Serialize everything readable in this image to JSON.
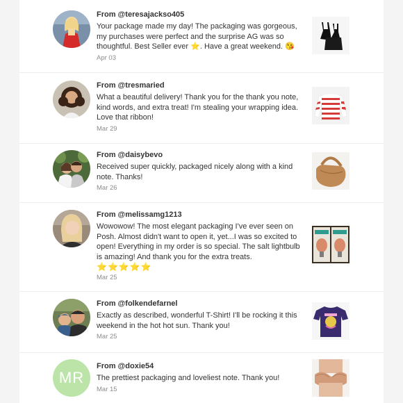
{
  "reviews": [
    {
      "from": "From @teresajackso405",
      "message": "Your package made my day! The packaging was gorgeous, my purchases were perfect and the surprise AG was so thoughtful. Best Seller ever ⭐. Have a great weekend. 😘",
      "date": "Apr 03",
      "avatar_icon": "avatar-photo-blonde-woman",
      "thumb_icon": "black-camisole-set-thumbnail"
    },
    {
      "from": "From @tresmaried",
      "message": "What a beautiful delivery! Thank you for the thank you note, kind words, and extra treat! I'm stealing your wrapping idea. Love that ribbon!",
      "date": "Mar 29",
      "avatar_icon": "avatar-photo-curly-hair-woman",
      "thumb_icon": "red-striped-sweater-thumbnail"
    },
    {
      "from": "From @daisybevo",
      "message": "Received super quickly, packaged nicely along with a kind note. Thanks!",
      "date": "Mar 26",
      "avatar_icon": "avatar-photo-couple",
      "thumb_icon": "tan-hobo-bag-thumbnail"
    },
    {
      "from": "From @melissamg1213",
      "message": "Wowowow! The most elegant packaging I've ever seen on Posh. Almost didn't want to open it, yet...I was so excited to open! Everything in my order is so special. The salt lightbulb is amazing! And thank you for the extra treats.",
      "stars": "⭐⭐⭐⭐⭐",
      "date": "Mar 25",
      "avatar_icon": "avatar-photo-blonde-woman-2",
      "thumb_icon": "salt-lightbulb-boxes-thumbnail"
    },
    {
      "from": "From @folkendefarnel",
      "message": "Exactly as described, wonderful T-Shirt! I'll be rocking it this weekend in the hot hot sun. Thank you!",
      "date": "Mar 25",
      "avatar_icon": "avatar-photo-man-and-child",
      "thumb_icon": "purple-tshirt-thumbnail"
    },
    {
      "from": "From @doxie54",
      "message": "The prettiest packaging and loveliest note. Thank you!",
      "date": "Mar 15",
      "avatar_initials": "MR",
      "thumb_icon": "nude-bra-thumbnail"
    }
  ],
  "colors": {
    "background": "#f4f4f5",
    "panel": "#ffffff",
    "initials_avatar": "#bde4a8",
    "date_text": "#8c8c8c"
  }
}
